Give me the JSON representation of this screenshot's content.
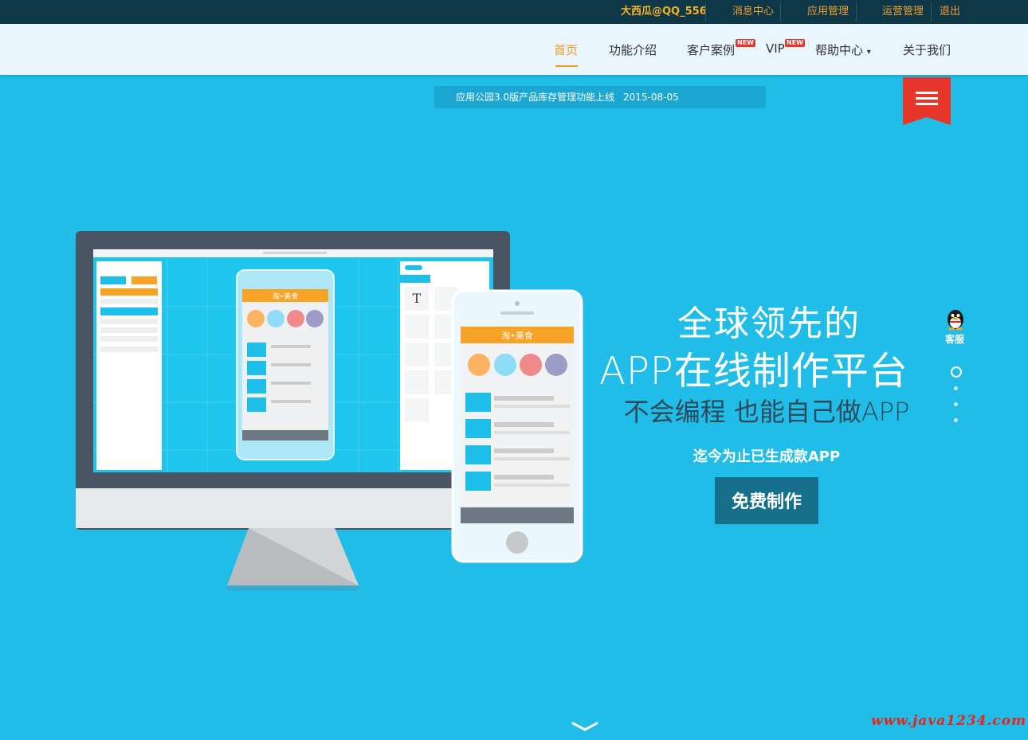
{
  "topbar": {
    "user": "大西瓜@QQ_556",
    "links": [
      "消息中心",
      "应用管理",
      "运营管理",
      "退出"
    ]
  },
  "nav": {
    "items": [
      "首页",
      "功能介绍",
      "客户案例",
      "VIP",
      "帮助中心",
      "关于我们"
    ],
    "new_badge": "NEW",
    "help_caret": "▾"
  },
  "announcement": {
    "text": "应用公园3.0版产品库存管理功能上线",
    "date": "2015-08-05"
  },
  "hero": {
    "line1": "全球领先的",
    "line2": "APP在线制作平台",
    "line3": "不会编程 也能自己做APP",
    "line4": "迄今为止已生成款APP",
    "cta": "免费制作"
  },
  "illustration": {
    "app_title": "淘•美食",
    "tool_text_icon": "T"
  },
  "sidebar": {
    "kefu": "客服"
  },
  "watermark": "www.java1234.com",
  "colors": {
    "bg": "#1fbde8",
    "accent": "#f39a1a",
    "topbar": "#0e3747",
    "cta": "#166f8b",
    "ribbon": "#e8352a"
  }
}
